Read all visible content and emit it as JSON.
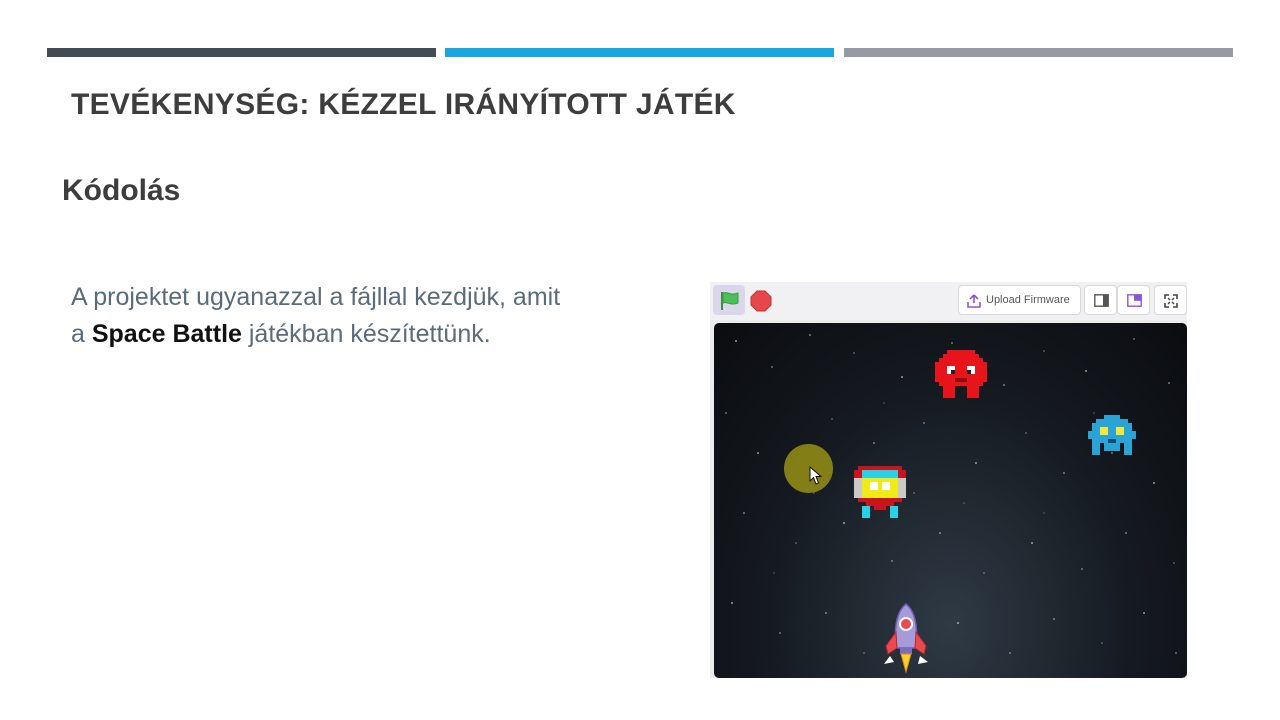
{
  "slide": {
    "title": "TEVÉKENYSÉG: KÉZZEL IRÁNYÍTOTT JÁTÉK",
    "subtitle": "Kódolás",
    "body": {
      "line1": "A projektet ugyanazzal a fájllal kezdjük, amit",
      "line2_prefix": "a ",
      "line2_bold": "Space Battle",
      "line2_suffix": " játékban készítettünk."
    }
  },
  "stage": {
    "toolbar": {
      "green_flag_icon": "green-flag-icon",
      "stop_icon": "stop-icon",
      "upload_label": "Upload Firmware"
    },
    "sprites": [
      "red-invader-icon",
      "blue-invader-icon",
      "yellow-robot-icon",
      "rocket-icon"
    ]
  },
  "colors": {
    "bar_dark": "#424c55",
    "bar_blue": "#1aa6e0",
    "bar_gray": "#949ba2"
  }
}
